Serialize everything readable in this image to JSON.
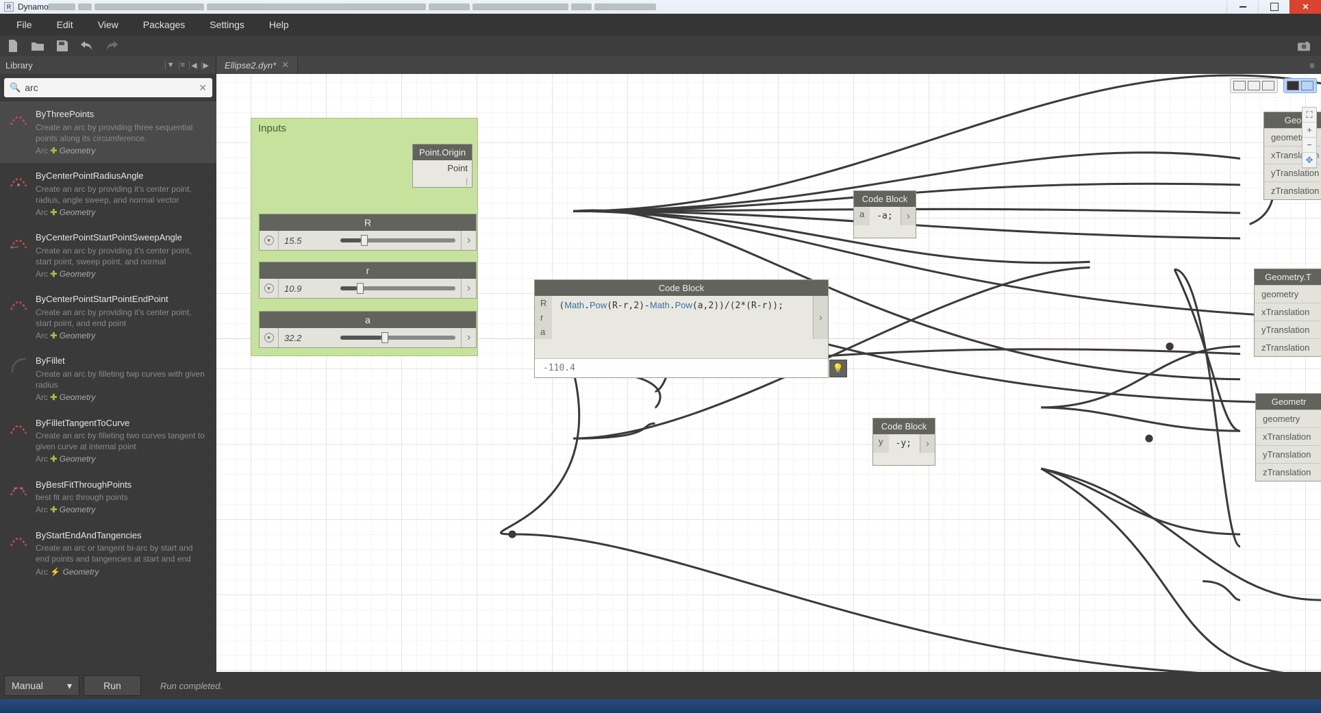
{
  "window": {
    "title": "Dynamo"
  },
  "menu": [
    "File",
    "Edit",
    "View",
    "Packages",
    "Settings",
    "Help"
  ],
  "library": {
    "title": "Library",
    "search": "arc",
    "results": [
      {
        "name": "ByThreePoints",
        "desc": "Create an arc by providing three sequential points along its circumference.",
        "cat": "Arc",
        "pkg": "Geometry",
        "kind": "plus"
      },
      {
        "name": "ByCenterPointRadiusAngle",
        "desc": "Create an arc by providing it's center point, radius, angle sweep, and normal vector",
        "cat": "Arc",
        "pkg": "Geometry",
        "kind": "plus"
      },
      {
        "name": "ByCenterPointStartPointSweepAngle",
        "desc": "Create an arc by providing it's center point, start point, sweep point, and normal",
        "cat": "Arc",
        "pkg": "Geometry",
        "kind": "plus"
      },
      {
        "name": "ByCenterPointStartPointEndPoint",
        "desc": "Create an arc by providing it's center point, start point, and end point",
        "cat": "Arc",
        "pkg": "Geometry",
        "kind": "plus"
      },
      {
        "name": "ByFillet",
        "desc": "Create an arc by filleting twp curves with given radius",
        "cat": "Arc",
        "pkg": "Geometry",
        "kind": "plus"
      },
      {
        "name": "ByFilletTangentToCurve",
        "desc": "Create an arc by filleting two curves tangent to given curve at internal point",
        "cat": "Arc",
        "pkg": "Geometry",
        "kind": "plus"
      },
      {
        "name": "ByBestFitThroughPoints",
        "desc": "best fit arc through points",
        "cat": "Arc",
        "pkg": "Geometry",
        "kind": "plus"
      },
      {
        "name": "ByStartEndAndTangencies",
        "desc": "Create an arc or tangent bi-arc by start and end points and tangencies at start and end",
        "cat": "Arc",
        "pkg": "Geometry",
        "kind": "bolt"
      }
    ]
  },
  "tab": {
    "name": "Ellipse2.dyn*"
  },
  "group": {
    "title": "Inputs"
  },
  "nodes": {
    "pointOrigin": {
      "title": "Point.Origin",
      "out": "Point"
    },
    "sliderR": {
      "title": "R",
      "value": "15.5",
      "pct": 18
    },
    "sliderr": {
      "title": "r",
      "value": "10.9",
      "pct": 14
    },
    "slidera": {
      "title": "a",
      "value": "32.2",
      "pct": 36
    },
    "cbNegA": {
      "title": "Code Block",
      "in": [
        "a"
      ],
      "expr": "-a;",
      "out": ">"
    },
    "cbNegY": {
      "title": "Code Block",
      "in": [
        "y"
      ],
      "expr": "-y;",
      "out": ">"
    },
    "cbMain": {
      "title": "Code Block",
      "in": [
        "R",
        "r",
        "a"
      ],
      "expr": "(Math.Pow(R-r,2)-Math.Pow(a,2))/(2*(R-r));",
      "result": "-110.4"
    },
    "geoTop": {
      "title": "Geo",
      "ports": [
        "geometry",
        "xTranslation",
        "yTranslation",
        "zTranslation"
      ]
    },
    "geoMid": {
      "title": "Geometry.T",
      "ports": [
        "geometry",
        "xTranslation",
        "yTranslation",
        "zTranslation"
      ]
    },
    "geoBot": {
      "title": "Geometr",
      "ports": [
        "geometry",
        "xTranslation",
        "yTranslation",
        "zTranslation"
      ]
    }
  },
  "status": {
    "mode": "Manual",
    "run": "Run",
    "message": "Run completed."
  }
}
